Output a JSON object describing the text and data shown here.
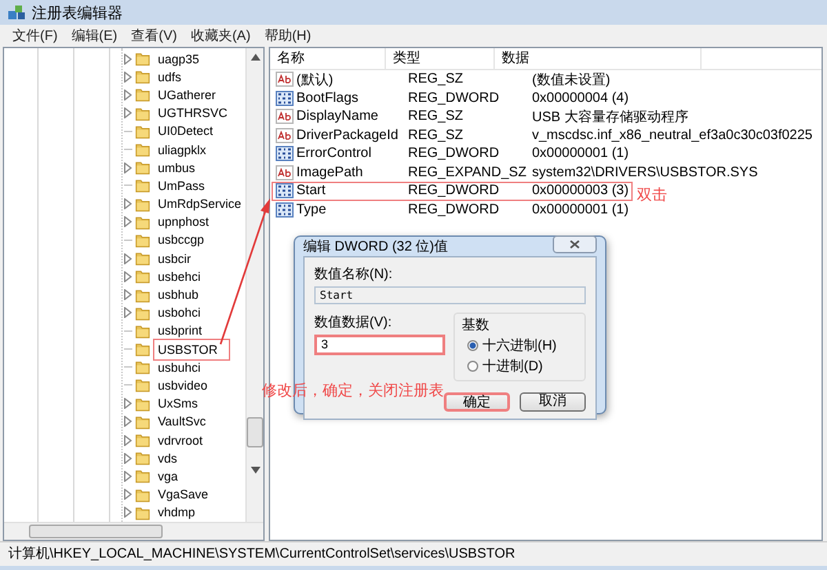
{
  "window": {
    "title": "注册表编辑器"
  },
  "menu": [
    "文件(F)",
    "编辑(E)",
    "查看(V)",
    "收藏夹(A)",
    "帮助(H)"
  ],
  "tree": {
    "items": [
      {
        "label": "uagp35",
        "expandable": true,
        "marked": false
      },
      {
        "label": "udfs",
        "expandable": true,
        "marked": false
      },
      {
        "label": "UGatherer",
        "expandable": true,
        "marked": false
      },
      {
        "label": "UGTHRSVC",
        "expandable": true,
        "marked": false
      },
      {
        "label": "UI0Detect",
        "expandable": false,
        "marked": false
      },
      {
        "label": "uliagpklx",
        "expandable": false,
        "marked": false
      },
      {
        "label": "umbus",
        "expandable": true,
        "marked": false
      },
      {
        "label": "UmPass",
        "expandable": false,
        "marked": false
      },
      {
        "label": "UmRdpService",
        "expandable": true,
        "marked": false
      },
      {
        "label": "upnphost",
        "expandable": true,
        "marked": false
      },
      {
        "label": "usbccgp",
        "expandable": false,
        "marked": false
      },
      {
        "label": "usbcir",
        "expandable": true,
        "marked": false
      },
      {
        "label": "usbehci",
        "expandable": true,
        "marked": false
      },
      {
        "label": "usbhub",
        "expandable": true,
        "marked": false
      },
      {
        "label": "usbohci",
        "expandable": true,
        "marked": false
      },
      {
        "label": "usbprint",
        "expandable": false,
        "marked": false
      },
      {
        "label": "USBSTOR",
        "expandable": false,
        "marked": true
      },
      {
        "label": "usbuhci",
        "expandable": false,
        "marked": false
      },
      {
        "label": "usbvideo",
        "expandable": false,
        "marked": false
      },
      {
        "label": "UxSms",
        "expandable": true,
        "marked": false
      },
      {
        "label": "VaultSvc",
        "expandable": true,
        "marked": false
      },
      {
        "label": "vdrvroot",
        "expandable": true,
        "marked": false
      },
      {
        "label": "vds",
        "expandable": true,
        "marked": false
      },
      {
        "label": "vga",
        "expandable": true,
        "marked": false
      },
      {
        "label": "VgaSave",
        "expandable": true,
        "marked": false
      },
      {
        "label": "vhdmp",
        "expandable": true,
        "marked": false
      }
    ]
  },
  "values": {
    "columns": [
      "名称",
      "类型",
      "数据"
    ],
    "rows": [
      {
        "kind": "string",
        "name": "(默认)",
        "type": "REG_SZ",
        "data": "(数值未设置)",
        "marked": false
      },
      {
        "kind": "number",
        "name": "BootFlags",
        "type": "REG_DWORD",
        "data": "0x00000004 (4)",
        "marked": false
      },
      {
        "kind": "string",
        "name": "DisplayName",
        "type": "REG_SZ",
        "data": "USB 大容量存储驱动程序",
        "marked": false
      },
      {
        "kind": "string",
        "name": "DriverPackageId",
        "type": "REG_SZ",
        "data": "v_mscdsc.inf_x86_neutral_ef3a0c30c03f0225",
        "marked": false
      },
      {
        "kind": "number",
        "name": "ErrorControl",
        "type": "REG_DWORD",
        "data": "0x00000001 (1)",
        "marked": false
      },
      {
        "kind": "string",
        "name": "ImagePath",
        "type": "REG_EXPAND_SZ",
        "data": "system32\\DRIVERS\\USBSTOR.SYS",
        "marked": false
      },
      {
        "kind": "number",
        "name": "Start",
        "type": "REG_DWORD",
        "data": "0x00000003 (3)",
        "marked": true
      },
      {
        "kind": "number",
        "name": "Type",
        "type": "REG_DWORD",
        "data": "0x00000001 (1)",
        "marked": false
      }
    ]
  },
  "dialog": {
    "title": "编辑 DWORD (32 位)值",
    "name_label": "数值名称(N):",
    "name_value": "Start",
    "data_label": "数值数据(V):",
    "data_field": {
      "value": "3",
      "marked": true
    },
    "base_label": "基数",
    "bases": [
      {
        "label": "十六进制(H)",
        "selected": true
      },
      {
        "label": "十进制(D)",
        "selected": false
      }
    ],
    "buttons": [
      {
        "label": "确定",
        "marked": true
      },
      {
        "label": "取消",
        "marked": false
      }
    ]
  },
  "annotations": [
    {
      "text": "双击"
    },
    {
      "text": "修改后，确定，关闭注册表"
    }
  ],
  "status_bar": "计算机\\HKEY_LOCAL_MACHINE\\SYSTEM\\CurrentControlSet\\services\\USBSTOR"
}
